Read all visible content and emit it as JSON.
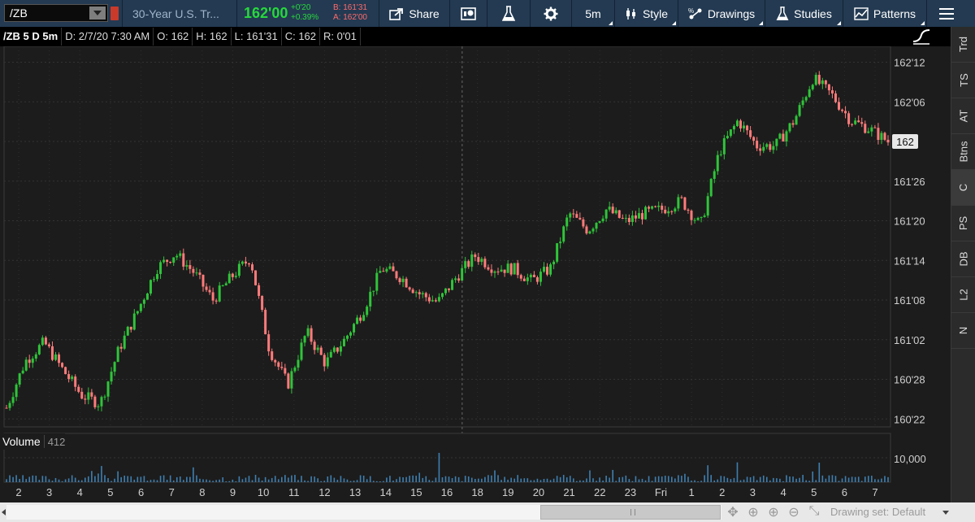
{
  "toolbar": {
    "symbol": "/ZB",
    "description": "30-Year U.S. Tr...",
    "last": "162'00",
    "change": "+0'20",
    "change_pct": "+0.39%",
    "bid": "B: 161'31",
    "ask": "A: 162'00",
    "share_label": "Share",
    "timeframe_label": "5m",
    "style_label": "Style",
    "drawings_label": "Drawings",
    "studies_label": "Studies",
    "patterns_label": "Patterns",
    "colors": {
      "bar_bg": "#233a52",
      "up": "#27d83c",
      "down": "#ff6b6b"
    }
  },
  "header": {
    "symbol": "/ZB 5 D 5m",
    "date": "D: 2/7/20 7:30 AM",
    "open": "O: 162",
    "high": "H: 162",
    "low": "L: 161'31",
    "close": "C: 162",
    "range": "R: 0'01"
  },
  "sidebar": {
    "tabs": [
      "Trd",
      "TS",
      "AT",
      "Btns",
      "C",
      "PS",
      "DB",
      "L2",
      "N"
    ],
    "active": "C"
  },
  "volume": {
    "label": "Volume",
    "value": "412",
    "axis_label": "10,000"
  },
  "scrollbar": {
    "drawing_set": "Drawing set: Default"
  },
  "chart_data": {
    "type": "candlestick",
    "price_axis_labels": [
      "162'12",
      "162'06",
      "162",
      "161'26",
      "161'20",
      "161'14",
      "161'08",
      "161'02",
      "160'28",
      "160'22"
    ],
    "price_axis_values": [
      162.375,
      162.1875,
      162.0,
      161.8125,
      161.625,
      161.4375,
      161.25,
      161.0625,
      160.875,
      160.6875
    ],
    "current_price_label": "162",
    "current_price": 162.0,
    "ylim": [
      160.65,
      162.45
    ],
    "x_tick_labels": [
      "2",
      "3",
      "4",
      "5",
      "6",
      "7",
      "8",
      "9",
      "10",
      "11",
      "12",
      "13",
      "14",
      "15",
      "16",
      "18",
      "19",
      "20",
      "21",
      "22",
      "23",
      "Fri",
      "1",
      "2",
      "3",
      "4",
      "5",
      "6",
      "7"
    ],
    "day_separator_index": 15,
    "price_path": [
      [
        0,
        160.74
      ],
      [
        1,
        160.96
      ],
      [
        2,
        161.05
      ],
      [
        3,
        160.92
      ],
      [
        4,
        160.8
      ],
      [
        5,
        160.76
      ],
      [
        6,
        161.02
      ],
      [
        7,
        161.2
      ],
      [
        8,
        161.4
      ],
      [
        9,
        161.47
      ],
      [
        10,
        161.38
      ],
      [
        11,
        161.25
      ],
      [
        12,
        161.36
      ],
      [
        13,
        161.45
      ],
      [
        14,
        161.02
      ],
      [
        15,
        160.85
      ],
      [
        16,
        161.1
      ],
      [
        17,
        160.95
      ],
      [
        18,
        161.06
      ],
      [
        19,
        161.2
      ],
      [
        20,
        161.4
      ],
      [
        21,
        161.36
      ],
      [
        22,
        161.28
      ],
      [
        23,
        161.24
      ],
      [
        24,
        161.36
      ],
      [
        25,
        161.46
      ],
      [
        26,
        161.4
      ],
      [
        27,
        161.4
      ],
      [
        28,
        161.34
      ],
      [
        29,
        161.4
      ],
      [
        30,
        161.66
      ],
      [
        31,
        161.58
      ],
      [
        32,
        161.68
      ],
      [
        33,
        161.62
      ],
      [
        34,
        161.66
      ],
      [
        35,
        161.68
      ],
      [
        36,
        161.72
      ],
      [
        37,
        161.6
      ],
      [
        38,
        161.95
      ],
      [
        39,
        162.1
      ],
      [
        40,
        161.98
      ],
      [
        41,
        161.98
      ],
      [
        42,
        162.1
      ],
      [
        43,
        162.3
      ],
      [
        44,
        162.22
      ],
      [
        45,
        162.1
      ],
      [
        46,
        162.06
      ],
      [
        47,
        162.0
      ]
    ]
  }
}
